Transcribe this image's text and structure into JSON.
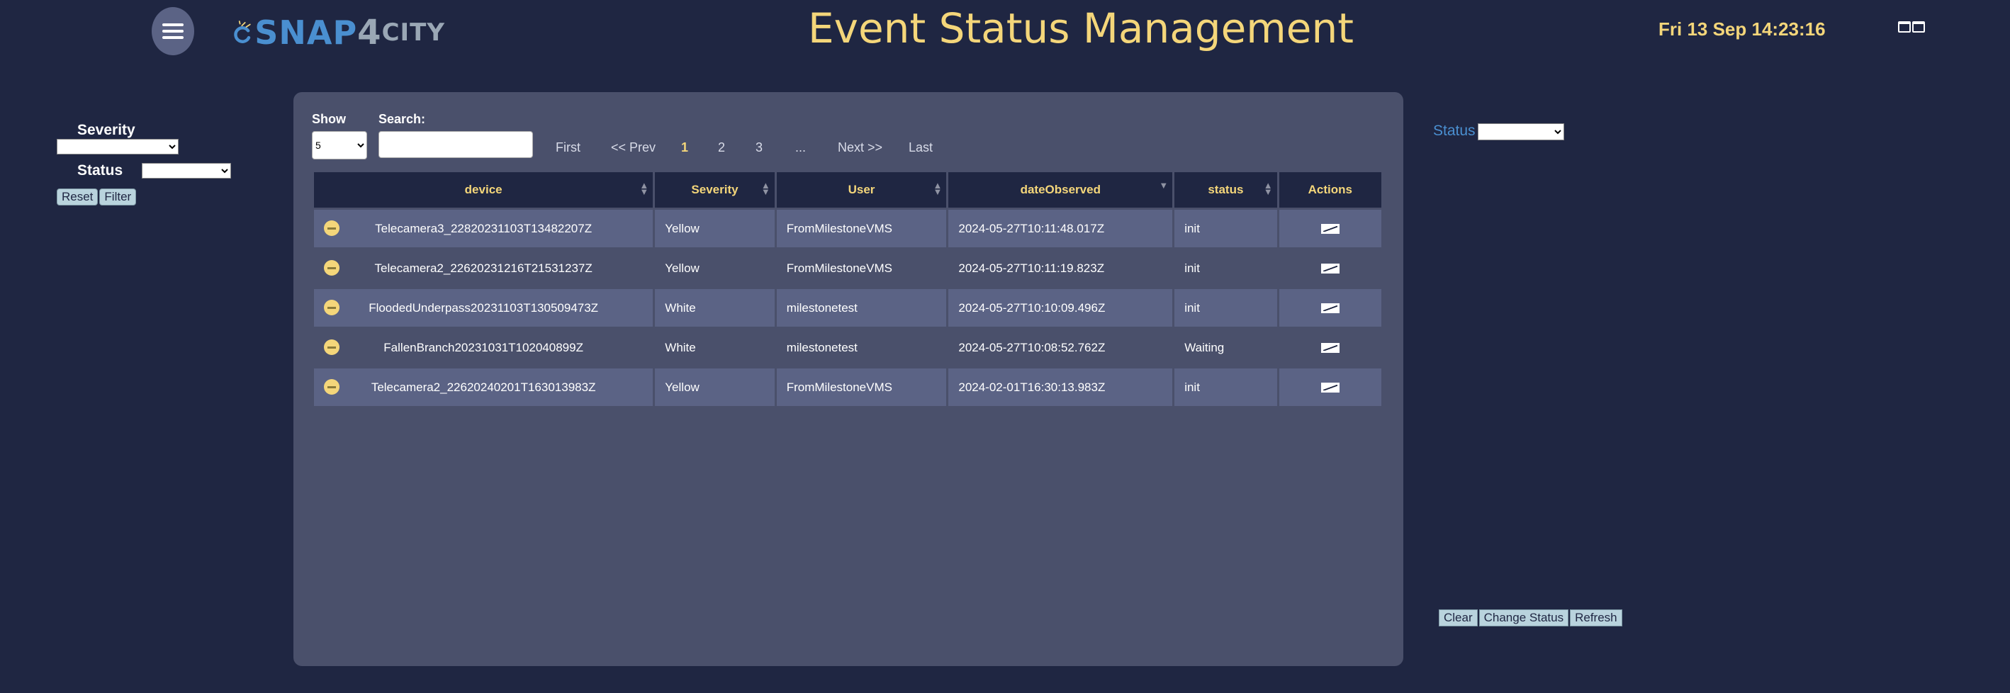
{
  "header": {
    "title": "Event Status Management",
    "datetime": "Fri 13 Sep 14:23:16",
    "logo": {
      "snap": "SNAP",
      "four": "4",
      "city": "CITY"
    }
  },
  "filters": {
    "severity_label": "Severity",
    "status_label": "Status",
    "reset_label": "Reset",
    "filter_label": "Filter"
  },
  "table_controls": {
    "show_label": "Show",
    "show_value": "5",
    "search_label": "Search:",
    "search_value": "",
    "pagination": [
      "First",
      "<< Prev",
      "1",
      "2",
      "3",
      "...",
      "Next >>",
      "Last"
    ],
    "active_page": "1"
  },
  "table": {
    "columns": [
      "device",
      "Severity",
      "User",
      "dateObserved",
      "status",
      "Actions"
    ],
    "rows": [
      {
        "device": "Telecamera3_22820231103T13482207Z",
        "severity": "Yellow",
        "user": "FromMilestoneVMS",
        "dateObserved": "2024-05-27T10:11:48.017Z",
        "status": "init"
      },
      {
        "device": "Telecamera2_22620231216T21531237Z",
        "severity": "Yellow",
        "user": "FromMilestoneVMS",
        "dateObserved": "2024-05-27T10:11:19.823Z",
        "status": "init"
      },
      {
        "device": "FloodedUnderpass20231103T130509473Z",
        "severity": "White",
        "user": "milestonetest",
        "dateObserved": "2024-05-27T10:10:09.496Z",
        "status": "init"
      },
      {
        "device": "FallenBranch20231031T102040899Z",
        "severity": "White",
        "user": "milestonetest",
        "dateObserved": "2024-05-27T10:08:52.762Z",
        "status": "Waiting"
      },
      {
        "device": "Telecamera2_22620240201T163013983Z",
        "severity": "Yellow",
        "user": "FromMilestoneVMS",
        "dateObserved": "2024-02-01T16:30:13.983Z",
        "status": "init"
      }
    ]
  },
  "right_panel": {
    "status_label": "Status",
    "clear_label": "Clear",
    "change_status_label": "Change Status",
    "refresh_label": "Refresh"
  },
  "colors": {
    "background": "#1f2642",
    "panel": "#4a506b",
    "row_alt": "#5b6385",
    "accent_yellow": "#f4d67a",
    "link_blue": "#4a8fd0"
  }
}
